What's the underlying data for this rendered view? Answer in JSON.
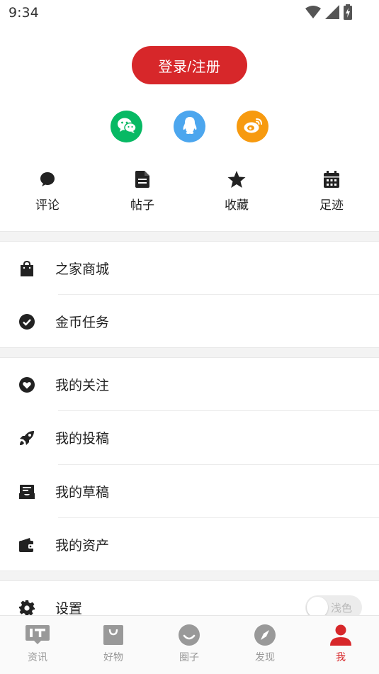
{
  "status_bar": {
    "time": "9:34"
  },
  "login": {
    "label": "登录/注册"
  },
  "quick_actions": [
    {
      "label": "评论",
      "icon": "comment-icon"
    },
    {
      "label": "帖子",
      "icon": "document-icon"
    },
    {
      "label": "收藏",
      "icon": "star-icon"
    },
    {
      "label": "足迹",
      "icon": "calendar-icon"
    }
  ],
  "menu": {
    "mall": "之家商城",
    "coin_tasks": "金币任务",
    "my_follows": "我的关注",
    "my_posts": "我的投稿",
    "my_drafts": "我的草稿",
    "my_assets": "我的资产",
    "settings": "设置"
  },
  "theme_toggle": {
    "label": "浅色",
    "on": false
  },
  "tabs": [
    {
      "label": "资讯",
      "icon": "news-icon",
      "active": false
    },
    {
      "label": "好物",
      "icon": "shopping-bag-icon",
      "active": false
    },
    {
      "label": "圈子",
      "icon": "circle-icon",
      "active": false
    },
    {
      "label": "发现",
      "icon": "compass-icon",
      "active": false
    },
    {
      "label": "我",
      "icon": "user-icon",
      "active": true
    }
  ],
  "colors": {
    "accent": "#d7272a",
    "wechat": "#07b964",
    "qq": "#4ca6ee",
    "weibo": "#f79a0f"
  }
}
